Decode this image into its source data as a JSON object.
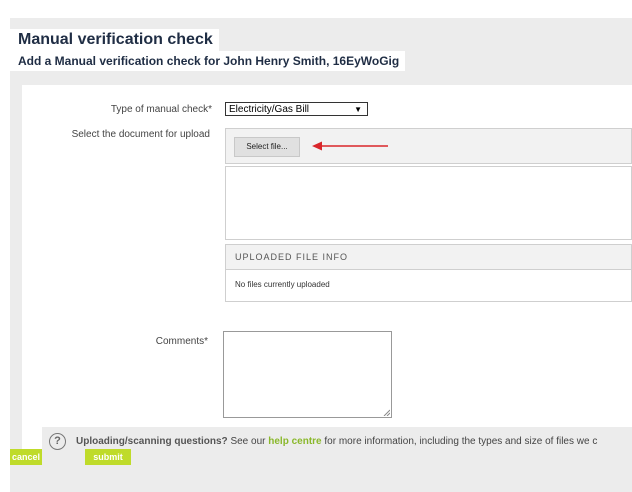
{
  "header": {
    "title": "Manual verification check",
    "subtitle": "Add a Manual verification check for John Henry Smith, 16EyWoGig"
  },
  "form": {
    "type_label": "Type of manual check*",
    "type_value": "Electricity/Gas Bill",
    "document_label": "Select the document for upload",
    "select_file_label": "Select file...",
    "uploaded_info_header": "UPLOADED FILE INFO",
    "uploaded_info_text": "No files currently uploaded",
    "comments_label": "Comments*",
    "comments_value": ""
  },
  "help": {
    "question": "Uploading/scanning questions?",
    "text_before": " See our ",
    "link": "help centre",
    "text_after": " for more information, including the types and size of files we c"
  },
  "actions": {
    "cancel": "cancel",
    "submit": "submit"
  },
  "colors": {
    "accent": "#bfdb2a",
    "link": "#8ab82b",
    "annotation_arrow": "#d9262b"
  }
}
